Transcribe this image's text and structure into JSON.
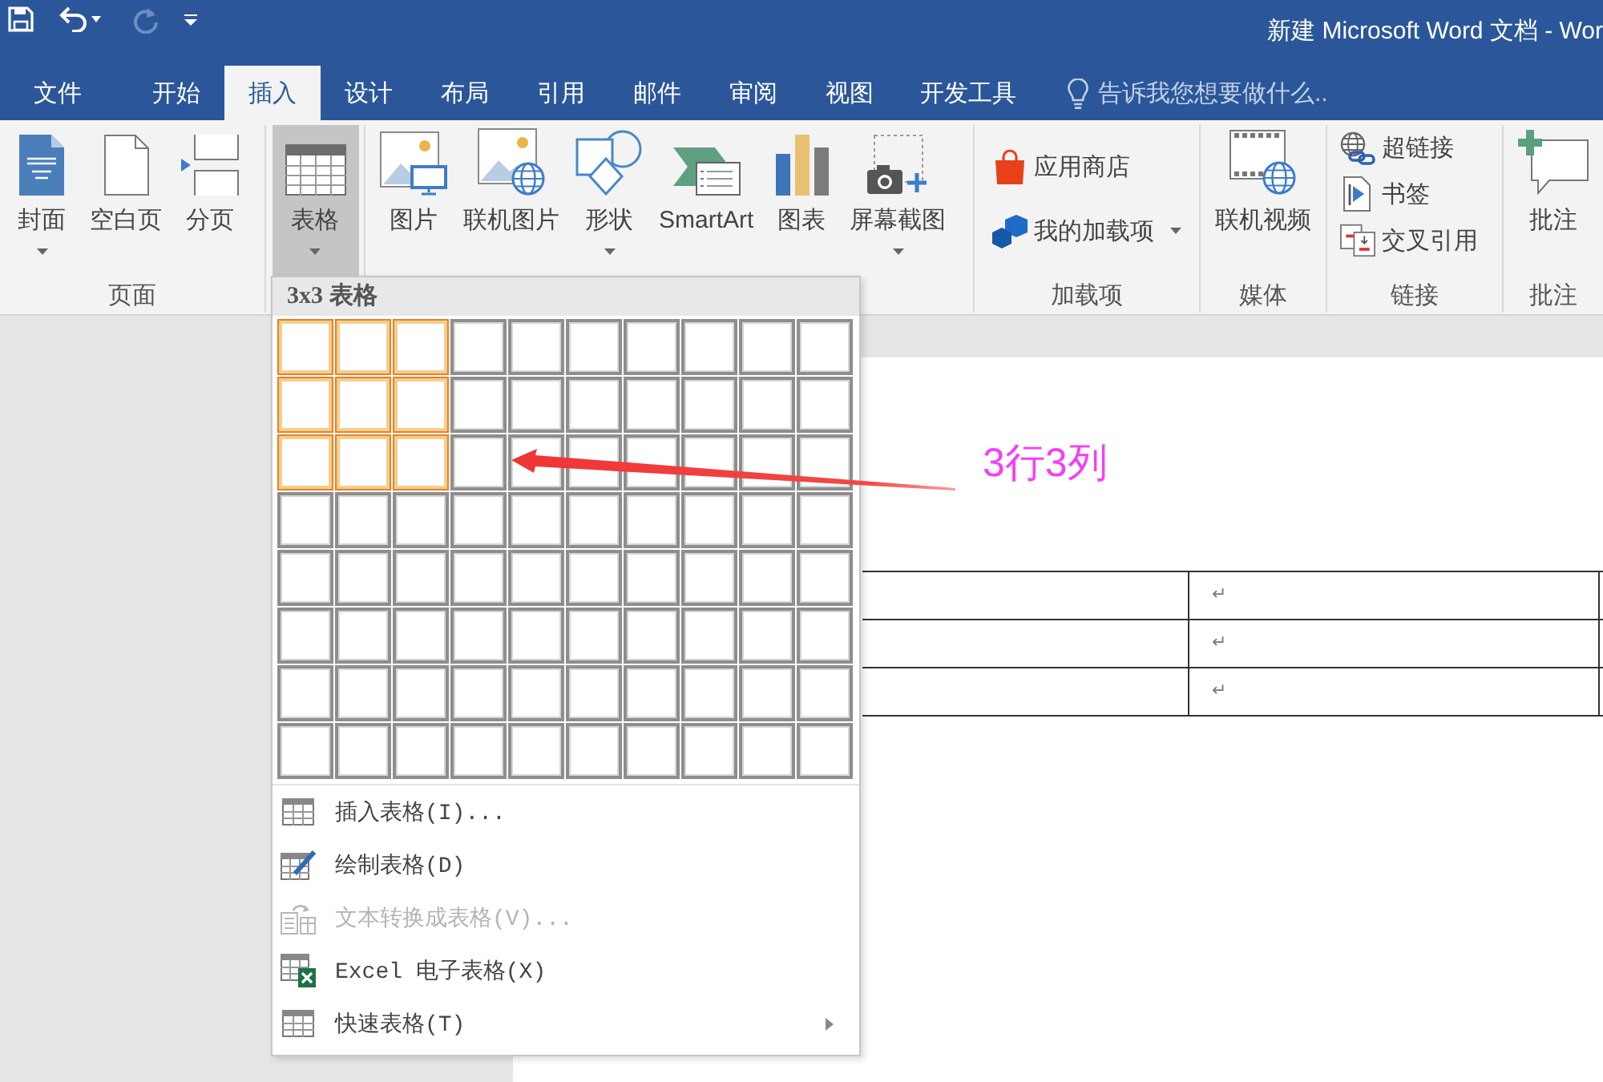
{
  "title_bar": {
    "quick_access": [
      {
        "disabled": false
      },
      {
        "disabled": false
      },
      {
        "disabled": true
      },
      {
        "disabled": false
      }
    ],
    "title": "新建 Microsoft Word 文档 - Wor"
  },
  "tabs": [
    {
      "label": "文件",
      "selected": false
    },
    {
      "label": "开始",
      "selected": false
    },
    {
      "label": "插入",
      "selected": true
    },
    {
      "label": "设计",
      "selected": false
    },
    {
      "label": "布局",
      "selected": false
    },
    {
      "label": "引用",
      "selected": false
    },
    {
      "label": "邮件",
      "selected": false
    },
    {
      "label": "审阅",
      "selected": false
    },
    {
      "label": "视图",
      "selected": false
    },
    {
      "label": "开发工具",
      "selected": false
    }
  ],
  "tell_me": {
    "placeholder": "告诉我您想要做什么.."
  },
  "ribbon": {
    "groups": [
      {
        "kind": "large",
        "label": "页面",
        "items": [
          {
            "label": "封面",
            "dropdown": true,
            "pressed": false
          },
          {
            "label": "空白页",
            "dropdown": false,
            "pressed": false
          },
          {
            "label": "分页",
            "dropdown": false,
            "pressed": false
          }
        ]
      },
      {
        "kind": "large",
        "items": [
          {
            "label": "表格",
            "dropdown": true,
            "pressed": true
          }
        ]
      },
      {
        "kind": "large",
        "items": [
          {
            "label": "图片",
            "dropdown": false,
            "pressed": false
          },
          {
            "label": "联机图片",
            "dropdown": false,
            "pressed": false
          },
          {
            "label": "形状",
            "dropdown": true,
            "pressed": false
          },
          {
            "label": "SmartArt",
            "dropdown": false,
            "pressed": false
          },
          {
            "label": "图表",
            "dropdown": false,
            "pressed": false
          },
          {
            "label": "屏幕截图",
            "dropdown": true,
            "pressed": false
          }
        ]
      },
      {
        "kind": "small",
        "label": "加载项",
        "items": [
          {
            "label": "应用商店",
            "dropdown": false
          },
          {
            "label": "我的加载项",
            "dropdown": true
          }
        ]
      },
      {
        "kind": "large",
        "label": "媒体",
        "items": [
          {
            "label": "联机视频",
            "dropdown": false,
            "pressed": false
          }
        ]
      },
      {
        "kind": "small",
        "label": "链接",
        "items": [
          {
            "label": "超链接",
            "dropdown": false
          },
          {
            "label": "书签",
            "dropdown": false
          },
          {
            "label": "交叉引用",
            "dropdown": false
          }
        ]
      },
      {
        "kind": "large",
        "label": "批注",
        "items": [
          {
            "label": "批注",
            "dropdown": false,
            "pressed": false
          }
        ]
      }
    ]
  },
  "table_menu": {
    "header": "3x3 表格",
    "grid": [
      {
        "cells": [
          {
            "selected": true
          },
          {
            "selected": true
          },
          {
            "selected": true
          },
          {
            "selected": false
          },
          {
            "selected": false
          },
          {
            "selected": false
          },
          {
            "selected": false
          },
          {
            "selected": false
          },
          {
            "selected": false
          },
          {
            "selected": false
          }
        ]
      },
      {
        "cells": [
          {
            "selected": true
          },
          {
            "selected": true
          },
          {
            "selected": true
          },
          {
            "selected": false
          },
          {
            "selected": false
          },
          {
            "selected": false
          },
          {
            "selected": false
          },
          {
            "selected": false
          },
          {
            "selected": false
          },
          {
            "selected": false
          }
        ]
      },
      {
        "cells": [
          {
            "selected": true
          },
          {
            "selected": true
          },
          {
            "selected": true
          },
          {
            "selected": false
          },
          {
            "selected": false
          },
          {
            "selected": false
          },
          {
            "selected": false
          },
          {
            "selected": false
          },
          {
            "selected": false
          },
          {
            "selected": false
          }
        ]
      },
      {
        "cells": [
          {
            "selected": false
          },
          {
            "selected": false
          },
          {
            "selected": false
          },
          {
            "selected": false
          },
          {
            "selected": false
          },
          {
            "selected": false
          },
          {
            "selected": false
          },
          {
            "selected": false
          },
          {
            "selected": false
          },
          {
            "selected": false
          }
        ]
      },
      {
        "cells": [
          {
            "selected": false
          },
          {
            "selected": false
          },
          {
            "selected": false
          },
          {
            "selected": false
          },
          {
            "selected": false
          },
          {
            "selected": false
          },
          {
            "selected": false
          },
          {
            "selected": false
          },
          {
            "selected": false
          },
          {
            "selected": false
          }
        ]
      },
      {
        "cells": [
          {
            "selected": false
          },
          {
            "selected": false
          },
          {
            "selected": false
          },
          {
            "selected": false
          },
          {
            "selected": false
          },
          {
            "selected": false
          },
          {
            "selected": false
          },
          {
            "selected": false
          },
          {
            "selected": false
          },
          {
            "selected": false
          }
        ]
      },
      {
        "cells": [
          {
            "selected": false
          },
          {
            "selected": false
          },
          {
            "selected": false
          },
          {
            "selected": false
          },
          {
            "selected": false
          },
          {
            "selected": false
          },
          {
            "selected": false
          },
          {
            "selected": false
          },
          {
            "selected": false
          },
          {
            "selected": false
          }
        ]
      },
      {
        "cells": [
          {
            "selected": false
          },
          {
            "selected": false
          },
          {
            "selected": false
          },
          {
            "selected": false
          },
          {
            "selected": false
          },
          {
            "selected": false
          },
          {
            "selected": false
          },
          {
            "selected": false
          },
          {
            "selected": false
          },
          {
            "selected": false
          }
        ]
      }
    ],
    "items": [
      {
        "label": "插入表格(I)...",
        "disabled": false,
        "submenu": false
      },
      {
        "label": "绘制表格(D)",
        "disabled": false,
        "submenu": false
      },
      {
        "label": "文本转换成表格(V)...",
        "disabled": true,
        "submenu": false
      },
      {
        "label": "Excel 电子表格(X)",
        "disabled": false,
        "submenu": false
      },
      {
        "label": "快速表格(T)",
        "disabled": false,
        "submenu": true
      }
    ]
  },
  "document": {
    "table_rows": [
      {
        "column_2": "↵"
      },
      {
        "column_2": "↵"
      },
      {
        "column_2": "↵"
      }
    ]
  },
  "annotation": {
    "text": "3行3列"
  }
}
